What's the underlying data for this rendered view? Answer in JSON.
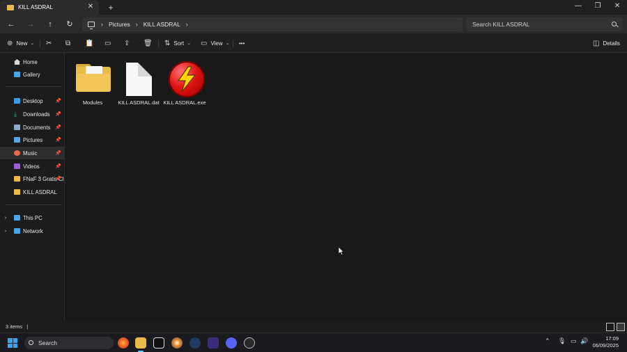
{
  "window": {
    "tab_title": "KILL ASDRAL",
    "new_tab_symbol": "+",
    "close_symbol": "✕"
  },
  "address_bar": {
    "breadcrumbs": [
      "Pictures",
      "KILL ASDRAL"
    ],
    "search_placeholder": "Search KILL ASDRAL"
  },
  "command_bar": {
    "new_label": "New",
    "sort_label": "Sort",
    "view_label": "View",
    "more_label": "•••",
    "details_label": "Details"
  },
  "sidebar": {
    "top_items": [
      {
        "label": "Home",
        "icon": "home-icon"
      },
      {
        "label": "Gallery",
        "icon": "gallery-icon"
      }
    ],
    "quick_access": [
      {
        "label": "Desktop",
        "icon": "desktop-icon",
        "pinned": true
      },
      {
        "label": "Downloads",
        "icon": "downloads-icon",
        "pinned": true
      },
      {
        "label": "Documents",
        "icon": "documents-icon",
        "pinned": true
      },
      {
        "label": "Pictures",
        "icon": "pictures-icon",
        "pinned": true
      },
      {
        "label": "Music",
        "icon": "music-icon",
        "pinned": true
      },
      {
        "label": "Videos",
        "icon": "videos-icon",
        "pinned": true
      },
      {
        "label": "FNaF 3 Gratis Cl",
        "icon": "folder-icon",
        "pinned": true
      },
      {
        "label": "KILL ASDRAL",
        "icon": "folder-icon",
        "pinned": false
      }
    ],
    "tree": [
      {
        "label": "This PC",
        "icon": "this-pc-icon"
      },
      {
        "label": "Network",
        "icon": "network-icon"
      }
    ]
  },
  "files": [
    {
      "name": "Modules",
      "icon": "folder-icon"
    },
    {
      "name": "KILL ASDRAL.dat",
      "icon": "file-icon"
    },
    {
      "name": "KILL ASDRAL.exe",
      "icon": "exe-lightning-icon"
    }
  ],
  "status_bar": {
    "item_count": "3 items",
    "separator": "|"
  },
  "taskbar": {
    "search_label": "Search",
    "time": "17:09",
    "date": "06/09/2025"
  },
  "colors": {
    "folder": "#e9b949",
    "accent": "#60cdff",
    "exe_red": "#e01212",
    "bolt_yellow": "#ffd400"
  }
}
